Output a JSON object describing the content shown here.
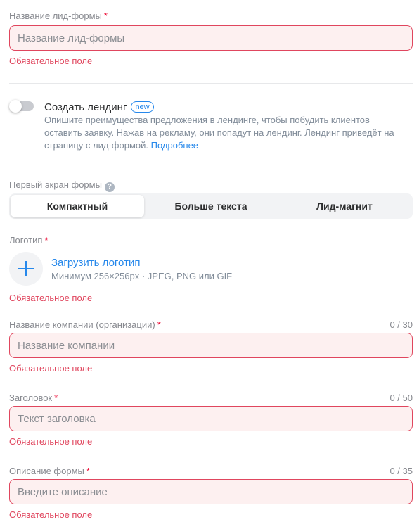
{
  "form_name": {
    "label": "Название лид-формы",
    "required_mark": "*",
    "placeholder": "Название лид-формы",
    "error": "Обязательное поле"
  },
  "landing": {
    "toggle_on": false,
    "title": "Создать лендинг",
    "badge": "new",
    "description": "Опишите преимущества предложения в лендинге, чтобы побудить клиентов оставить заявку. Нажав на рекламу, они попадут на лендинг. Лендинг приведёт на страницу с лид-формой.",
    "link": "Подробнее"
  },
  "first_screen": {
    "label": "Первый экран формы",
    "help_icon": "?",
    "options": [
      "Компактный",
      "Больше текста",
      "Лид-магнит"
    ],
    "selected": "Компактный"
  },
  "logo": {
    "label": "Логотип",
    "required_mark": "*",
    "upload_label": "Загрузить логотип",
    "hint": "Минимум 256×256px · JPEG, PNG или GIF",
    "error": "Обязательное поле"
  },
  "company": {
    "label": "Название компании (организации)",
    "required_mark": "*",
    "counter": "0 / 30",
    "placeholder": "Название компании",
    "error": "Обязательное поле"
  },
  "headline": {
    "label": "Заголовок",
    "required_mark": "*",
    "counter": "0 / 50",
    "placeholder": "Текст заголовка",
    "error": "Обязательное поле"
  },
  "form_description": {
    "label": "Описание формы",
    "required_mark": "*",
    "counter": "0 / 35",
    "placeholder": "Введите описание",
    "error": "Обязательное поле"
  },
  "colors": {
    "error": "#e0465e",
    "link": "#2688eb",
    "input_error_bg": "#fdf0f0"
  }
}
